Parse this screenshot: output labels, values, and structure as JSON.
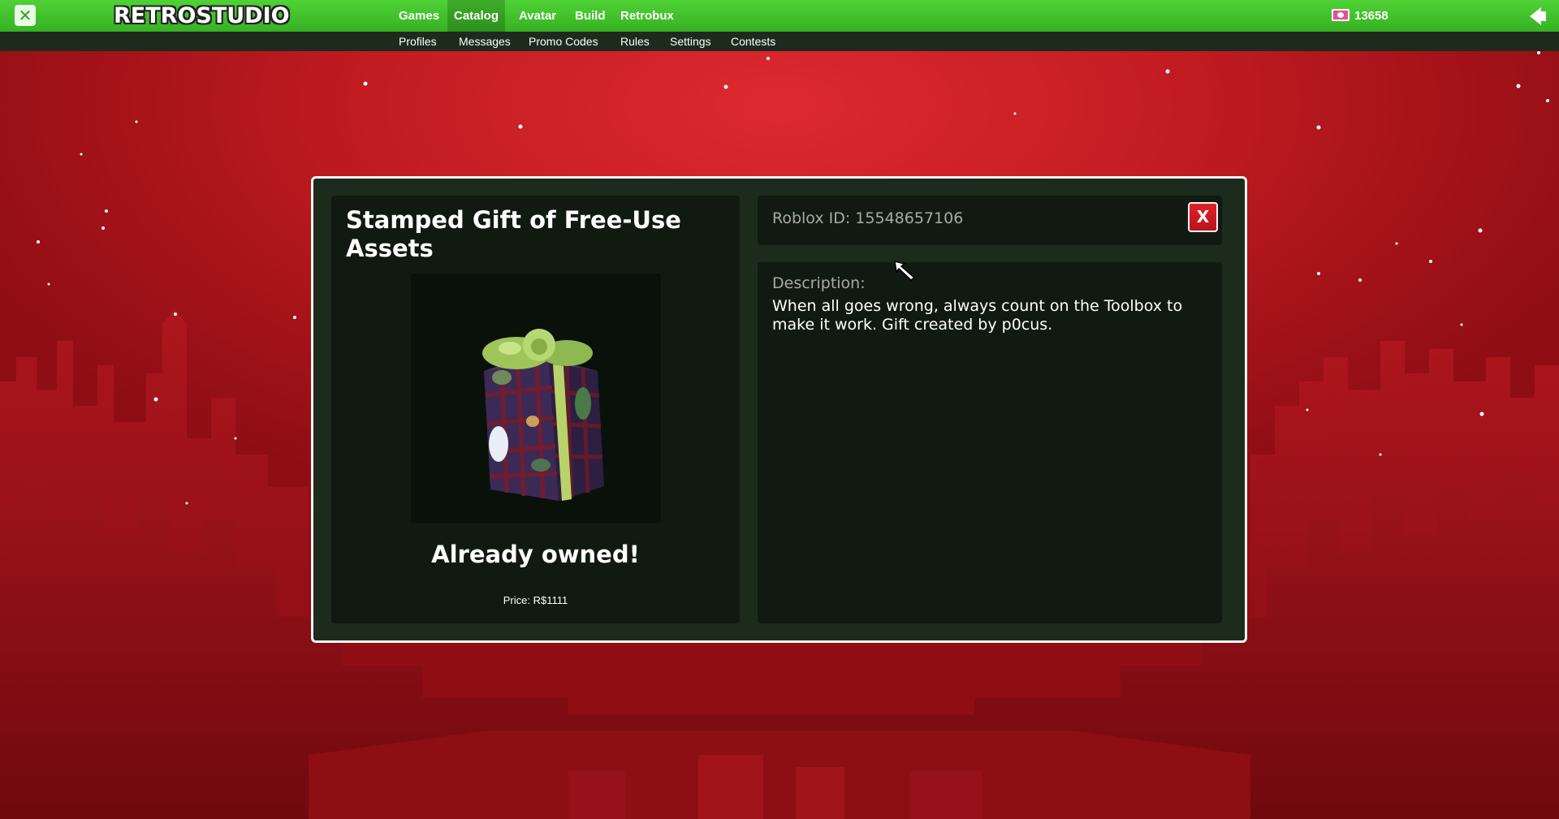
{
  "topbar": {
    "close_glyph": "✕",
    "logo": "RETROSTUDIO",
    "nav": [
      {
        "label": "Games",
        "active": false
      },
      {
        "label": "Catalog",
        "active": true
      },
      {
        "label": "Avatar",
        "active": false
      },
      {
        "label": "Build",
        "active": false
      },
      {
        "label": "Retrobux",
        "active": false
      }
    ],
    "currency_amount": "13658",
    "currency_icon": "cash-icon",
    "menu_icon": "speaker-icon"
  },
  "subnav": [
    {
      "label": "Profiles"
    },
    {
      "label": "Messages"
    },
    {
      "label": "Promo Codes"
    },
    {
      "label": "Rules"
    },
    {
      "label": "Settings"
    },
    {
      "label": "Contests"
    }
  ],
  "item": {
    "title": "Stamped Gift of Free-Use Assets",
    "status": "Already owned!",
    "price": "Price: R$1111",
    "roblox_id": "Roblox ID: 15548657106",
    "close_label": "X",
    "description_label": "Description:",
    "description": "When all goes wrong, always count on the Toolbox to make it work. Gift created by p0cus."
  },
  "colors": {
    "topbar_green": "#3fc22a",
    "background_red": "#c21c22",
    "panel_dark": "#111a11",
    "close_red": "#d01a22"
  }
}
